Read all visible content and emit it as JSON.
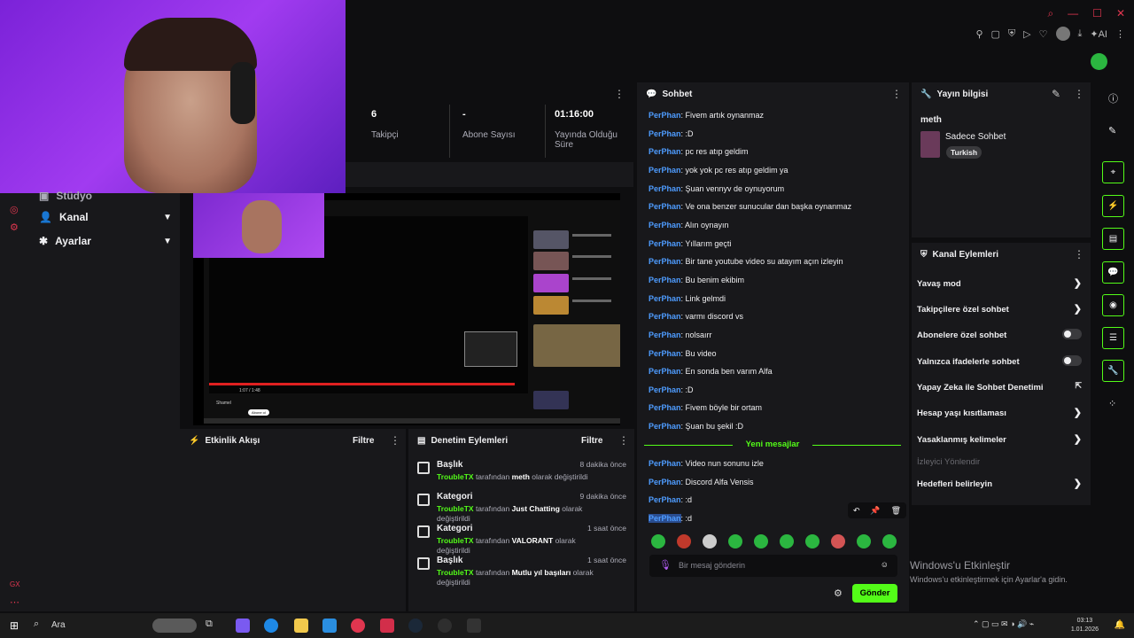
{
  "sidebar": {
    "items": [
      {
        "label": "Stüdyo",
        "icon": "studio-icon"
      },
      {
        "label": "Kanal",
        "icon": "user-icon"
      },
      {
        "label": "Ayarlar",
        "icon": "gear-icon"
      }
    ],
    "bottom_label": "GX"
  },
  "stats": [
    {
      "value": "6",
      "label": "Takipçi"
    },
    {
      "value": "-",
      "label": "Abone Sayısı"
    },
    {
      "value": "01:16:00",
      "label": "Yayında Olduğu Süre"
    }
  ],
  "activity_feed": {
    "title": "Etkinlik Akışı",
    "filter": "Filtre"
  },
  "mod_actions": {
    "title": "Denetim Eylemleri",
    "filter": "Filtre",
    "items": [
      {
        "title": "Başlık",
        "time": "8 dakika önce",
        "user": "TroubleTX",
        "mid": "tarafından",
        "value": "meth",
        "end": "olarak değiştirildi"
      },
      {
        "title": "Kategori",
        "time": "9 dakika önce",
        "user": "TroubleTX",
        "mid": "tarafından",
        "value": "Just Chatting",
        "end": "olarak değiştirildi"
      },
      {
        "title": "Kategori",
        "time": "1 saat önce",
        "user": "TroubleTX",
        "mid": "tarafından",
        "value": "VALORANT",
        "end": "olarak değiştirildi"
      },
      {
        "title": "Başlık",
        "time": "1 saat önce",
        "user": "TroubleTX",
        "mid": "tarafından",
        "value": "Mutlu yıl başıları",
        "end": "olarak değiştirildi"
      }
    ]
  },
  "chat": {
    "title": "Sohbet",
    "messages": [
      {
        "user": "PerPhan",
        "text": ": Fivem artık oynanmaz"
      },
      {
        "user": "PerPhan",
        "text": ": :D"
      },
      {
        "user": "PerPhan",
        "text": ": pc res atıp geldim"
      },
      {
        "user": "PerPhan",
        "text": ": yok yok pc res atıp geldim ya"
      },
      {
        "user": "PerPhan",
        "text": ": Şuan vennyv de oynuyorum"
      },
      {
        "user": "PerPhan",
        "text": ": Ve ona benzer sunucular dan başka oynanmaz"
      },
      {
        "user": "PerPhan",
        "text": ": Alın oynayın"
      },
      {
        "user": "PerPhan",
        "text": ": Yıllarım geçti"
      },
      {
        "user": "PerPhan",
        "text": ": Bir tane youtube video su atayım açın izleyin"
      },
      {
        "user": "PerPhan",
        "text": ": Bu benim ekibim"
      },
      {
        "user": "PerPhan",
        "text": ": Link gelmdi"
      },
      {
        "user": "PerPhan",
        "text": ": varmı discord vs"
      },
      {
        "user": "PerPhan",
        "text": ": nolsaırr"
      },
      {
        "user": "PerPhan",
        "text": ": Bu video"
      },
      {
        "user": "PerPhan",
        "text": ": En sonda ben varım Alfa"
      },
      {
        "user": "PerPhan",
        "text": ": :D"
      },
      {
        "user": "PerPhan",
        "text": ": Fivem böyle bir ortam"
      },
      {
        "user": "PerPhan",
        "text": ": Şuan bu şekil :D"
      }
    ],
    "new_messages_label": "Yeni mesajlar",
    "new_messages": [
      {
        "user": "PerPhan",
        "text": ": Video nun sonunu izle"
      },
      {
        "user": "PerPhan",
        "text": ": Discord Alfa Vensis"
      },
      {
        "user": "PerPhan",
        "text": ": :d"
      },
      {
        "user": "PerPhan",
        "text": ": :d"
      }
    ],
    "input_placeholder": "Bir mesaj gönderin",
    "send_label": "Gönder"
  },
  "stream_info": {
    "title": "Yayın bilgisi",
    "stream_title": "meth",
    "category": "Sadece Sohbet",
    "tag": "Turkish"
  },
  "channel_actions": {
    "title": "Kanal Eylemleri",
    "items": [
      {
        "label": "Yavaş mod",
        "control": "chevron"
      },
      {
        "label": "Takipçilere özel sohbet",
        "control": "chevron"
      },
      {
        "label": "Abonelere özel sohbet",
        "control": "toggle"
      },
      {
        "label": "Yalnızca ifadelerle sohbet",
        "control": "toggle"
      },
      {
        "label": "Yapay Zeka ile Sohbet Denetimi",
        "control": "external"
      },
      {
        "label": "Hesap yaşı kısıtlaması",
        "control": "chevron"
      },
      {
        "label": "Yasaklanmış kelimeler",
        "control": "chevron"
      },
      {
        "label": "İzleyici Yönlendir",
        "control": "none"
      },
      {
        "label": "Hedefleri belirleyin",
        "control": "chevron"
      }
    ]
  },
  "watermark": {
    "title": "Windows'u Etkinleştir",
    "subtitle": "Windows'u etkinleştirmek için Ayarlar'a gidin."
  },
  "taskbar": {
    "search": "Ara",
    "time": "03:13",
    "date": "1.01.2026"
  },
  "preview": {
    "yt_time": "1:07 / 1:48",
    "channel": "Shamel",
    "subscribe": "Abone ol"
  },
  "colors": {
    "accent": "#53fc18",
    "username": "#4e9cff",
    "panel": "#18181b",
    "bg": "#0e0e10"
  }
}
